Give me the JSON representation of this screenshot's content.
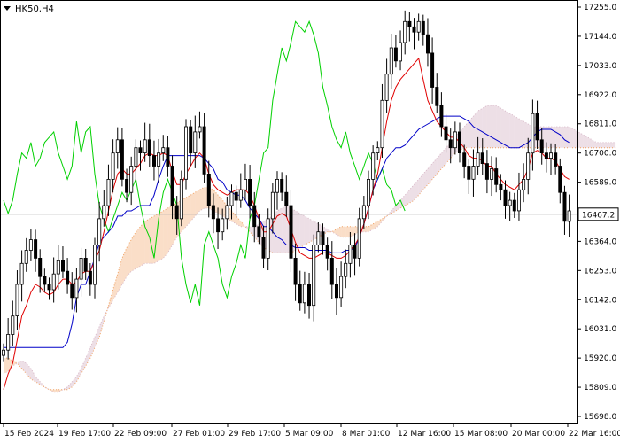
{
  "symbol_label": "HK50,H4",
  "colors": {
    "background": "#ffffff",
    "candle": "#000000",
    "tenkan": "#e00000",
    "kijun": "#0000c8",
    "chikou": "#00d000",
    "cloud_bull": "#d8b8c8",
    "cloud_bear": "#f0a060",
    "current_price_line": "#a8a8a8"
  },
  "chart_data": {
    "type": "candlestick",
    "title": "HK50,H4",
    "indicator": "Ichimoku",
    "ylim": [
      15698.0,
      17255.0
    ],
    "grid": false,
    "y_ticks": [
      "17255.0",
      "17144.0",
      "17033.0",
      "16922.0",
      "16811.0",
      "16700.0",
      "16589.0",
      "16364.0",
      "16253.0",
      "16142.0",
      "16031.0",
      "15920.0",
      "15809.0",
      "15698.0"
    ],
    "x_ticks": [
      "15 Feb 2024",
      "19 Feb 17:00",
      "22 Feb 09:00",
      "27 Feb 01:00",
      "29 Feb 17:00",
      "5 Mar 09:00",
      "8 Mar 01:00",
      "12 Mar 16:00",
      "15 Mar 08:00",
      "20 Mar 00:00",
      "22 Mar 16:00"
    ],
    "current_price": 16467.2,
    "current_price_label": "16467.2",
    "close": [
      15950,
      16010,
      16080,
      16200,
      16280,
      16330,
      16370,
      16300,
      16230,
      16200,
      16180,
      16240,
      16290,
      16250,
      16200,
      16150,
      16220,
      16300,
      16250,
      16200,
      16350,
      16450,
      16500,
      16600,
      16700,
      16750,
      16600,
      16550,
      16650,
      16720,
      16700,
      16750,
      16690,
      16650,
      16700,
      16720,
      16650,
      16500,
      16450,
      16600,
      16800,
      16700,
      16780,
      16800,
      16620,
      16500,
      16450,
      16400,
      16450,
      16500,
      16550,
      16520,
      16560,
      16600,
      16500,
      16420,
      16380,
      16300,
      16450,
      16550,
      16600,
      16550,
      16500,
      16300,
      16200,
      16130,
      16200,
      16120,
      16350,
      16400,
      16350,
      16300,
      16200,
      16150,
      16230,
      16280,
      16350,
      16300,
      16450,
      16500,
      16600,
      16700,
      16720,
      16900,
      17000,
      17100,
      17050,
      17120,
      17200,
      17180,
      17160,
      17200,
      17150,
      17080,
      16950,
      16880,
      16800,
      16750,
      16720,
      16780,
      16700,
      16650,
      16600,
      16650,
      16700,
      16660,
      16600,
      16640,
      16580,
      16560,
      16500,
      16520,
      16480,
      16560,
      16600,
      16700,
      16850,
      16750,
      16700,
      16680,
      16700,
      16650,
      16550,
      16440,
      16480
    ],
    "tenkan": [
      15800,
      15860,
      15900,
      15990,
      16080,
      16120,
      16170,
      16200,
      16190,
      16170,
      16160,
      16170,
      16200,
      16220,
      16220,
      16200,
      16210,
      16240,
      16250,
      16250,
      16290,
      16330,
      16400,
      16480,
      16560,
      16620,
      16640,
      16620,
      16620,
      16640,
      16660,
      16690,
      16700,
      16690,
      16690,
      16700,
      16690,
      16630,
      16580,
      16580,
      16620,
      16650,
      16680,
      16700,
      16680,
      16620,
      16580,
      16560,
      16550,
      16540,
      16550,
      16560,
      16560,
      16560,
      16540,
      16500,
      16450,
      16400,
      16400,
      16430,
      16460,
      16470,
      16460,
      16410,
      16360,
      16320,
      16310,
      16300,
      16300,
      16310,
      16320,
      16320,
      16310,
      16300,
      16300,
      16310,
      16330,
      16350,
      16380,
      16430,
      16490,
      16560,
      16620,
      16720,
      16820,
      16900,
      16950,
      16980,
      17000,
      17020,
      17040,
      17060,
      16980,
      16900,
      16860,
      16820,
      16800,
      16780,
      16760,
      16760,
      16740,
      16720,
      16690,
      16680,
      16680,
      16670,
      16650,
      16650,
      16620,
      16600,
      16580,
      16570,
      16560,
      16580,
      16600,
      16640,
      16700,
      16710,
      16700,
      16680,
      16680,
      16670,
      16640,
      16610,
      16600
    ],
    "kijun": [
      15960,
      15960,
      15960,
      15960,
      15960,
      15960,
      15960,
      15960,
      15960,
      15960,
      15960,
      15960,
      15960,
      15960,
      15980,
      16050,
      16150,
      16200,
      16200,
      16250,
      16300,
      16360,
      16380,
      16400,
      16420,
      16460,
      16460,
      16480,
      16480,
      16490,
      16500,
      16500,
      16500,
      16540,
      16600,
      16650,
      16690,
      16690,
      16690,
      16690,
      16690,
      16690,
      16690,
      16690,
      16680,
      16660,
      16640,
      16600,
      16590,
      16560,
      16550,
      16540,
      16540,
      16520,
      16490,
      16470,
      16450,
      16420,
      16420,
      16400,
      16380,
      16370,
      16350,
      16350,
      16340,
      16340,
      16340,
      16330,
      16330,
      16330,
      16330,
      16330,
      16320,
      16320,
      16320,
      16330,
      16330,
      16340,
      16380,
      16430,
      16490,
      16560,
      16600,
      16640,
      16680,
      16700,
      16720,
      16720,
      16730,
      16750,
      16770,
      16790,
      16800,
      16810,
      16820,
      16830,
      16840,
      16840,
      16840,
      16840,
      16840,
      16830,
      16820,
      16800,
      16790,
      16780,
      16770,
      16760,
      16750,
      16740,
      16730,
      16720,
      16720,
      16720,
      16730,
      16740,
      16760,
      16780,
      16790,
      16790,
      16790,
      16780,
      16770,
      16750,
      16740
    ],
    "chikou": [
      16520,
      16470,
      16520,
      16620,
      16700,
      16680,
      16740,
      16650,
      16680,
      16740,
      16760,
      16780,
      16700,
      16650,
      16600,
      16650,
      16820,
      16700,
      16780,
      16800,
      16620,
      16500,
      16450,
      16400,
      16450,
      16500,
      16550,
      16520,
      16560,
      16600,
      16500,
      16420,
      16380,
      16300,
      16450,
      16550,
      16600,
      16550,
      16500,
      16300,
      16200,
      16130,
      16200,
      16120,
      16350,
      16400,
      16350,
      16300,
      16200,
      16150,
      16230,
      16280,
      16350,
      16300,
      16450,
      16500,
      16600,
      16700,
      16720,
      16900,
      17000,
      17100,
      17050,
      17120,
      17200,
      17180,
      17160,
      17200,
      17150,
      17080,
      16950,
      16880,
      16800,
      16750,
      16720,
      16780,
      16700,
      16650,
      16600,
      16650,
      16700,
      16660,
      16600,
      16640,
      16580,
      16560,
      16500,
      16520,
      16480
    ],
    "senkou_a": [
      15860,
      15870,
      15890,
      15900,
      15910,
      15900,
      15880,
      15850,
      15830,
      15810,
      15800,
      15790,
      15790,
      15800,
      15810,
      15830,
      15850,
      15880,
      15920,
      15960,
      16000,
      16040,
      16080,
      16110,
      16140,
      16170,
      16200,
      16230,
      16250,
      16260,
      16270,
      16280,
      16280,
      16280,
      16290,
      16300,
      16320,
      16350,
      16380,
      16400,
      16420,
      16440,
      16460,
      16480,
      16490,
      16490,
      16480,
      16470,
      16460,
      16450,
      16440,
      16430,
      16420,
      16420,
      16420,
      16420,
      16430,
      16440,
      16450,
      16460,
      16480,
      16490,
      16500,
      16490,
      16480,
      16470,
      16460,
      16450,
      16440,
      16430,
      16420,
      16410,
      16400,
      16390,
      16380,
      16380,
      16380,
      16390,
      16400,
      16400,
      16400,
      16410,
      16420,
      16440,
      16460,
      16480,
      16500,
      16520,
      16540,
      16560,
      16580,
      16600,
      16620,
      16640,
      16660,
      16680,
      16700,
      16720,
      16740,
      16760,
      16780,
      16800,
      16820,
      16840,
      16860,
      16870,
      16880,
      16880,
      16880,
      16870,
      16860,
      16850,
      16840,
      16830,
      16820,
      16810,
      16800,
      16800,
      16800,
      16800,
      16800,
      16800,
      16800,
      16800,
      16800,
      16790,
      16780,
      16770,
      16760,
      16750,
      16740,
      16740,
      16740,
      16740,
      16740
    ],
    "senkou_b": [
      15920,
      15920,
      15910,
      15900,
      15880,
      15860,
      15840,
      15830,
      15820,
      15810,
      15800,
      15800,
      15800,
      15800,
      15800,
      15810,
      15830,
      15860,
      15890,
      15920,
      15960,
      16000,
      16060,
      16120,
      16180,
      16240,
      16300,
      16340,
      16370,
      16400,
      16420,
      16440,
      16450,
      16460,
      16470,
      16480,
      16490,
      16500,
      16510,
      16520,
      16530,
      16540,
      16550,
      16560,
      16570,
      16570,
      16560,
      16540,
      16520,
      16500,
      16480,
      16460,
      16440,
      16420,
      16400,
      16380,
      16360,
      16340,
      16330,
      16320,
      16320,
      16320,
      16320,
      16320,
      16330,
      16340,
      16350,
      16360,
      16370,
      16380,
      16390,
      16400,
      16400,
      16410,
      16420,
      16420,
      16420,
      16420,
      16420,
      16420,
      16420,
      16430,
      16440,
      16450,
      16460,
      16470,
      16480,
      16490,
      16500,
      16510,
      16520,
      16540,
      16560,
      16580,
      16600,
      16620,
      16640,
      16660,
      16680,
      16700,
      16710,
      16720,
      16720,
      16720,
      16720,
      16720,
      16720,
      16720,
      16720,
      16720,
      16720,
      16720,
      16720,
      16720,
      16720,
      16720,
      16720,
      16720,
      16720,
      16720,
      16720,
      16720,
      16720,
      16720,
      16720,
      16720,
      16720,
      16720,
      16720,
      16720,
      16720,
      16720,
      16720,
      16720,
      16720
    ]
  }
}
